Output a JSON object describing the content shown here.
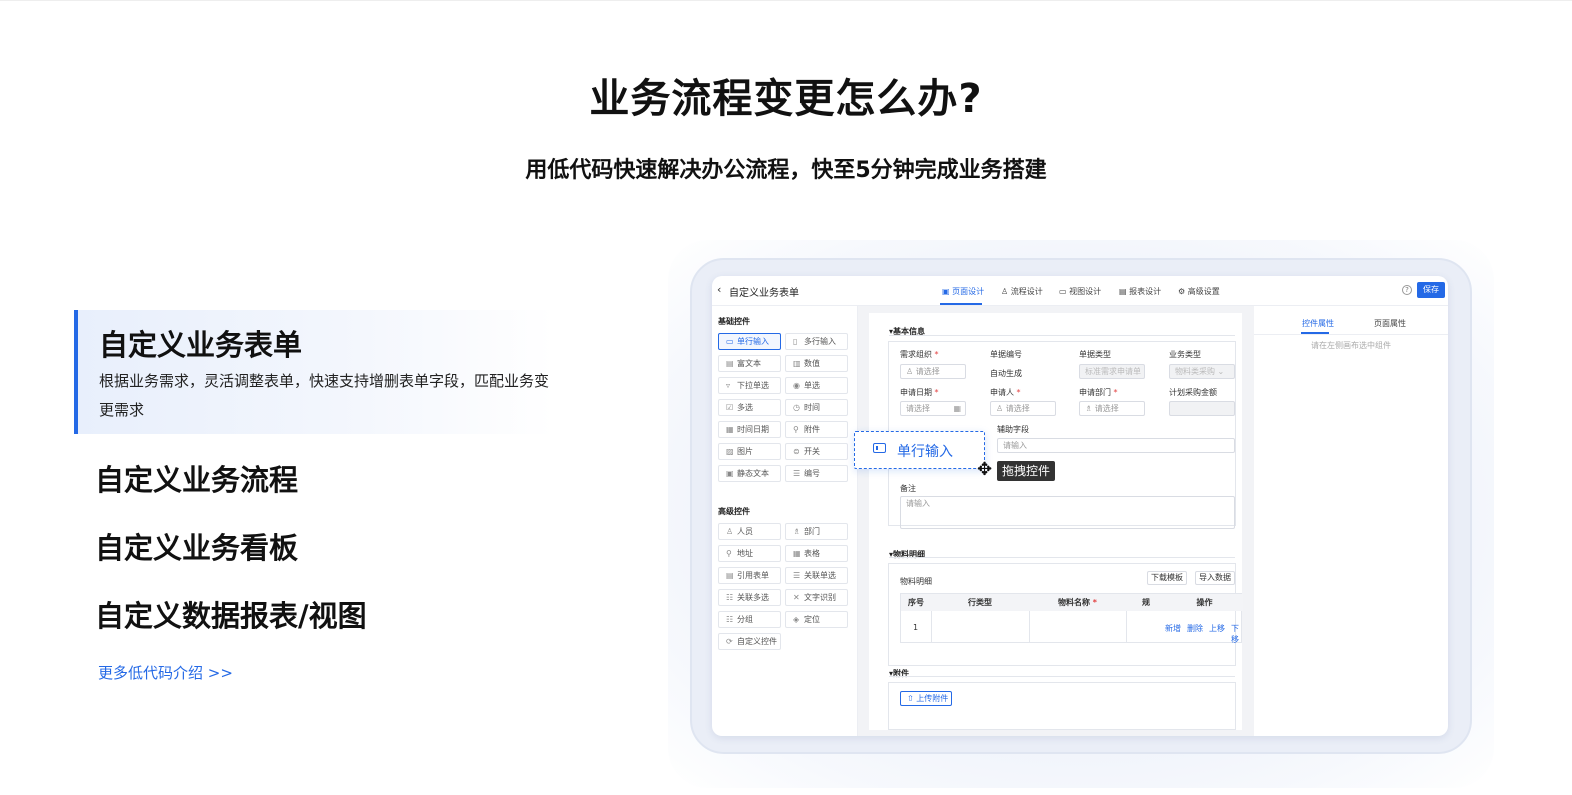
{
  "heading": "业务流程变更怎么办?",
  "subheading": "用低代码快速解决办公流程，快至5分钟完成业务搭建",
  "features": [
    {
      "title": "自定义业务表单",
      "desc": "根据业务需求，灵活调整表单，快速支持增删表单字段，匹配业务变更需求"
    },
    {
      "title": "自定义业务流程"
    },
    {
      "title": "自定义业务看板"
    },
    {
      "title": "自定义数据报表/视图"
    }
  ],
  "more_link": "更多低代码介绍 >>",
  "accent": "#2469e6",
  "app": {
    "title": "自定义业务表单",
    "tabs": [
      "页面设计",
      "流程设计",
      "视图设计",
      "报表设计",
      "高级设置"
    ],
    "save": "保存",
    "help": "?",
    "basic_section": "基础控件",
    "basic_controls": [
      "单行输入",
      "多行输入",
      "富文本",
      "数值",
      "下拉单选",
      "单选",
      "多选",
      "时间",
      "时间日期",
      "附件",
      "图片",
      "开关",
      "静态文本",
      "编号"
    ],
    "advanced_section": "高级控件",
    "advanced_controls": [
      "人员",
      "部门",
      "地址",
      "表格",
      "引用表单",
      "关联单选",
      "关联多选",
      "文字识别",
      "分组",
      "定位",
      "自定义控件"
    ],
    "group_basic": "基本信息",
    "fields": {
      "org": "需求组织",
      "org_ph": "请选择",
      "no": "单据编号",
      "no_val": "自动生成",
      "doctype": "单据类型",
      "doctype_ph": "标准需求申请单",
      "biztype": "业务类型",
      "biztype_ph": "物料类采购",
      "date": "申请日期",
      "date_ph": "请选择",
      "person": "申请人",
      "person_ph": "请选择",
      "dept": "申请部门",
      "dept_ph": "请选择",
      "amount": "计划采购金额",
      "aux": "辅助字段",
      "aux_ph": "请输入",
      "remark": "备注",
      "remark_ph": "请输入"
    },
    "group_material": "物料明细",
    "material_label": "物料明细",
    "download_template": "下载模板",
    "import_data": "导入数据",
    "table_headers": [
      "序号",
      "行类型",
      "物料名称",
      "规",
      "操作"
    ],
    "row_no": "1",
    "row_actions": [
      "新增",
      "删除",
      "上移",
      "下移"
    ],
    "group_attach": "附件",
    "upload": "上传附件",
    "right_tabs": [
      "控件属性",
      "页面属性"
    ],
    "right_hint": "请在左侧画布选中组件"
  },
  "drag_item": "单行输入",
  "drag_tip": "拖拽控件"
}
